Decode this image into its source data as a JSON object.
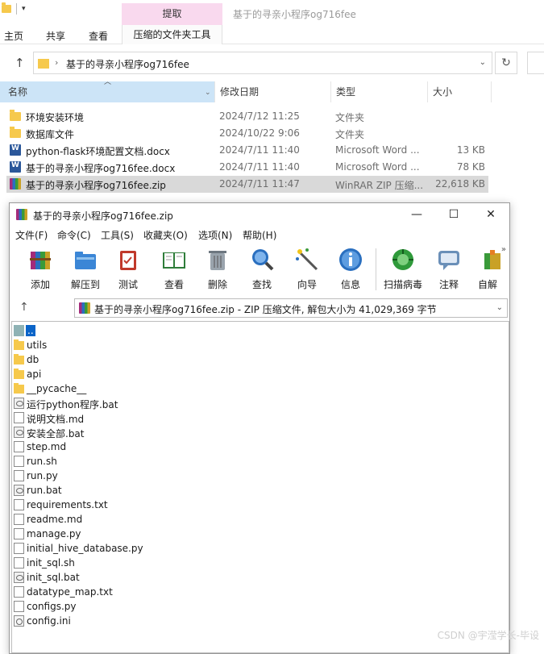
{
  "explorer": {
    "context_tab": "提取",
    "window_title": "基于的寻亲小程序og716fee",
    "menu_tabs": [
      "主页",
      "共享",
      "查看"
    ],
    "compressed_tools_tab": "压缩的文件夹工具",
    "address_path": "基于的寻亲小程序og716fee",
    "columns": {
      "name": "名称",
      "date": "修改日期",
      "type": "类型",
      "size": "大小"
    },
    "files": [
      {
        "name": "环境安装环境",
        "date": "2024/7/12 11:25",
        "type": "文件夹",
        "size": "",
        "icon": "folder-icon"
      },
      {
        "name": "数据库文件",
        "date": "2024/10/22 9:06",
        "type": "文件夹",
        "size": "",
        "icon": "folder-icon"
      },
      {
        "name": "python-flask环境配置文档.docx",
        "date": "2024/7/11 11:40",
        "type": "Microsoft Word ...",
        "size": "13 KB",
        "icon": "word-icon"
      },
      {
        "name": "基于的寻亲小程序og716fee.docx",
        "date": "2024/7/11 11:40",
        "type": "Microsoft Word ...",
        "size": "78 KB",
        "icon": "word-icon"
      },
      {
        "name": "基于的寻亲小程序og716fee.zip",
        "date": "2024/7/11 11:47",
        "type": "WinRAR ZIP 压缩...",
        "size": "22,618 KB",
        "icon": "winrar-icon",
        "selected": true
      }
    ]
  },
  "winrar": {
    "title": "基于的寻亲小程序og716fee.zip",
    "menu": [
      "文件(F)",
      "命令(C)",
      "工具(S)",
      "收藏夹(O)",
      "选项(N)",
      "帮助(H)"
    ],
    "toolbar": [
      "添加",
      "解压到",
      "测试",
      "查看",
      "删除",
      "查找",
      "向导",
      "信息",
      "扫描病毒",
      "注释",
      "自解"
    ],
    "archive_info": "基于的寻亲小程序og716fee.zip - ZIP 压缩文件, 解包大小为 41,029,369 字节",
    "items": [
      {
        "name": "..",
        "icon": "parent-folder-icon"
      },
      {
        "name": "utils",
        "icon": "folder-icon"
      },
      {
        "name": "db",
        "icon": "folder-icon"
      },
      {
        "name": "api",
        "icon": "folder-icon"
      },
      {
        "name": "__pycache__",
        "icon": "folder-icon"
      },
      {
        "name": "运行python程序.bat",
        "icon": "bat-icon"
      },
      {
        "name": "说明文档.md",
        "icon": "file-icon"
      },
      {
        "name": "安装全部.bat",
        "icon": "bat-icon"
      },
      {
        "name": "step.md",
        "icon": "file-icon"
      },
      {
        "name": "run.sh",
        "icon": "file-icon"
      },
      {
        "name": "run.py",
        "icon": "file-icon"
      },
      {
        "name": "run.bat",
        "icon": "bat-icon"
      },
      {
        "name": "requirements.txt",
        "icon": "file-icon"
      },
      {
        "name": "readme.md",
        "icon": "file-icon"
      },
      {
        "name": "manage.py",
        "icon": "file-icon"
      },
      {
        "name": "initial_hive_database.py",
        "icon": "file-icon"
      },
      {
        "name": "init_sql.sh",
        "icon": "file-icon"
      },
      {
        "name": "init_sql.bat",
        "icon": "bat-icon"
      },
      {
        "name": "datatype_map.txt",
        "icon": "file-icon"
      },
      {
        "name": "configs.py",
        "icon": "file-icon"
      },
      {
        "name": "config.ini",
        "icon": "settings-file-icon"
      }
    ]
  },
  "watermark": "CSDN @宇滢学长-毕设"
}
